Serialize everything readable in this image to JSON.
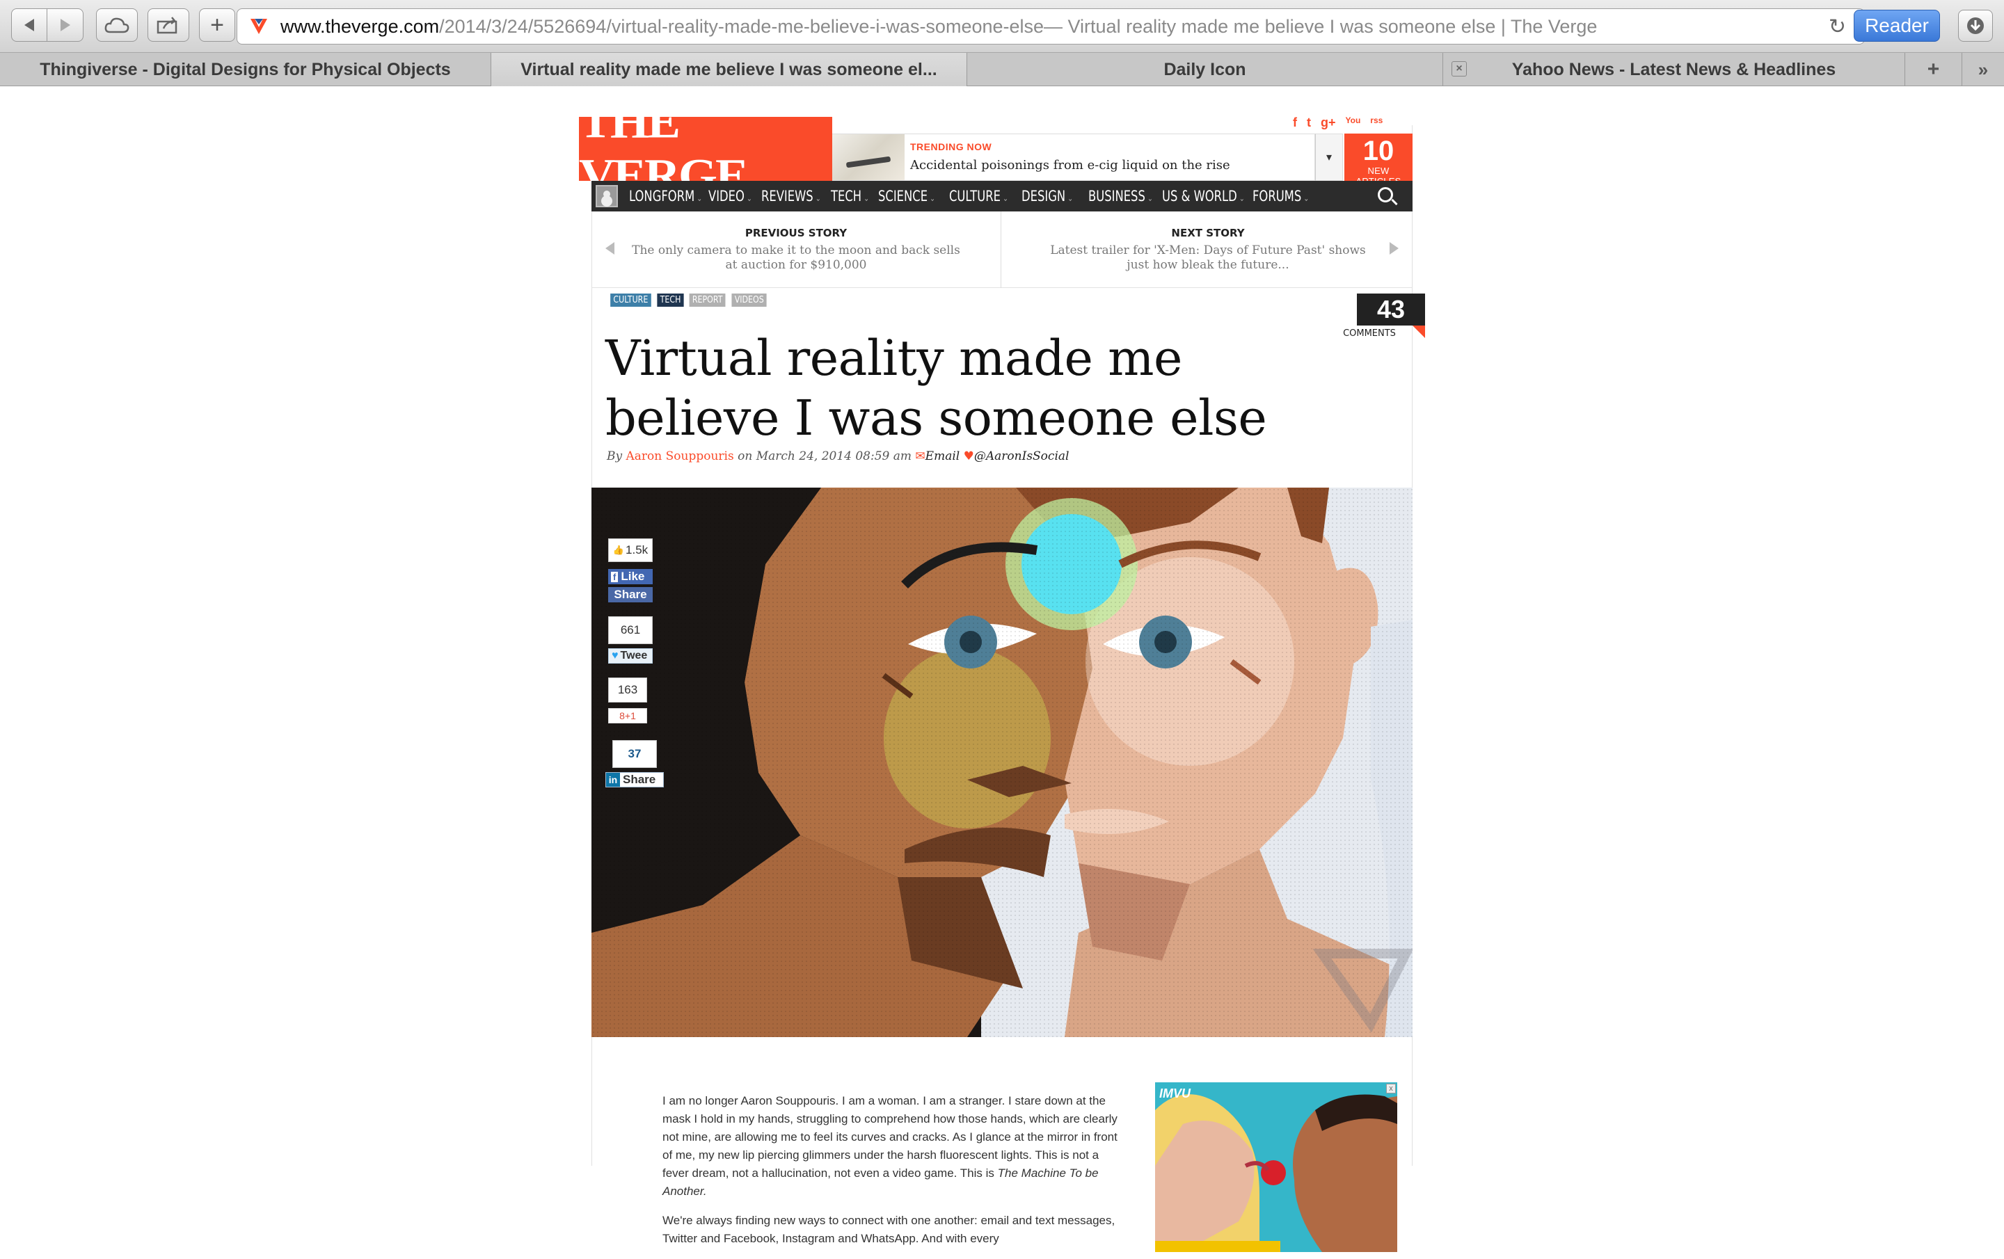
{
  "browser": {
    "url_domain": "www.theverge.com",
    "url_rest": "/2014/3/24/5526694/virtual-reality-made-me-believe-i-was-someone-else",
    "page_title_suffix": " — Virtual reality made me believe I was someone else | The Verge",
    "reader_label": "Reader",
    "tabs": [
      {
        "label": "Thingiverse - Digital Designs for Physical Objects"
      },
      {
        "label": "Virtual reality made me believe I was someone el..."
      },
      {
        "label": "Daily Icon"
      },
      {
        "label": "Yahoo News - Latest News & Headlines"
      }
    ],
    "new_tab_label": "+",
    "overflow_label": "»"
  },
  "site": {
    "logo": "THE VERGE",
    "trending_label": "TRENDING NOW",
    "trending_headline": "Accidental poisonings from e-cig liquid on the rise",
    "new_articles_count": "10",
    "new_articles_label": "NEW ARTICLES",
    "social": [
      "f",
      "t",
      "g+",
      "You",
      "rss"
    ],
    "brand_color": "#fa4b2a"
  },
  "nav": {
    "items": [
      "LONGFORM",
      "VIDEO",
      "REVIEWS",
      "TECH",
      "SCIENCE",
      "CULTURE",
      "DESIGN",
      "BUSINESS",
      "US & WORLD",
      "FORUMS"
    ]
  },
  "story_nav": {
    "prev_label": "PREVIOUS STORY",
    "prev_title": "The only camera to make it to the moon and back sells at auction for $910,000",
    "next_label": "NEXT STORY",
    "next_title": "Latest trailer for 'X-Men: Days of Future Past' shows just how bleak the future..."
  },
  "article": {
    "tags": [
      {
        "label": "CULTURE",
        "color": "#3d7fa8"
      },
      {
        "label": "TECH",
        "color": "#1f3550"
      },
      {
        "label": "REPORT",
        "color": "#b0b0b0"
      },
      {
        "label": "VIDEOS",
        "color": "#b0b0b0"
      }
    ],
    "comments_count": "43",
    "comments_label": "COMMENTS",
    "headline": "Virtual reality made me believe I was someone else",
    "byline_by": "By ",
    "author": "Aaron Souppouris",
    "date": " on March 24, 2014 08:59 am ",
    "email_label": "Email",
    "twitter_handle": "@AaronIsSocial",
    "body": [
      "I am no longer Aaron Souppouris. I am a woman. I am a stranger. I stare down at the mask I hold in my hands, struggling to comprehend how those hands, which are clearly not mine, are allowing me to feel its curves and cracks. As I glance at the mirror in front of me, my new lip piercing glimmers under the harsh fluorescent lights. This is not a fever dream, not a hallucination, not even a video game. This is ",
      "We're always finding new ways to connect with one another: email and text messages, Twitter and Facebook, Instagram and WhatsApp. And with every"
    ],
    "body_em": "The Machine To be Another."
  },
  "share": {
    "fb_count": "1.5k",
    "fb_like": "Like",
    "fb_share": "Share",
    "tw_count": "661",
    "tw_label": "Twee",
    "gp_count": "163",
    "gp_label": "8+1",
    "li_count": "37",
    "li_label": "Share"
  },
  "ad": {
    "logo": "IMVU",
    "close": "x"
  }
}
